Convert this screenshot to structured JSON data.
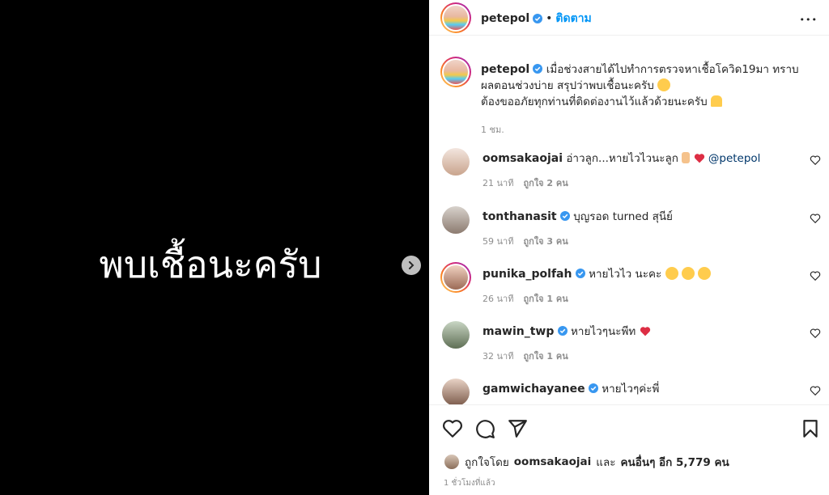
{
  "media": {
    "text": "พบเชื้อนะครับ"
  },
  "header": {
    "username": "petepol",
    "separator": "•",
    "follow_label": "ติดตาม",
    "more_label": "•••"
  },
  "caption": {
    "username": "petepol",
    "line1": "เมื่อช่วงสายได้ไปทำการตรวจหาเชื้อโควิด19มา ทราบผลตอนช่วงบ่าย สรุปว่าพบเชื้อนะครับ",
    "line2": "ต้องขออภัยทุกท่านที่ติดต่องานไว้แล้วด้วยนะครับ",
    "time": "1 ชม."
  },
  "comments": [
    {
      "username": "oomsakaojai",
      "verified": false,
      "text": "อ่าวลูก...หายไวไวนะลูก",
      "mention": "@petepol",
      "time": "21 นาที",
      "likes": "ถูกใจ 2 คน"
    },
    {
      "username": "tonthanasit",
      "verified": true,
      "text": "บุญรอด turned สุนีย์",
      "mention": "",
      "time": "59 นาที",
      "likes": "ถูกใจ 3 คน"
    },
    {
      "username": "punika_polfah",
      "verified": true,
      "text": "หายไวไว นะคะ",
      "mention": "",
      "time": "26 นาที",
      "likes": "ถูกใจ 1 คน"
    },
    {
      "username": "mawin_twp",
      "verified": true,
      "text": "หายไวๆนะพีท",
      "mention": "",
      "time": "32 นาที",
      "likes": "ถูกใจ 1 คน"
    },
    {
      "username": "gamwichayanee",
      "verified": true,
      "text": "หายไวๆค่ะพี่",
      "mention": "",
      "time": "",
      "likes": ""
    }
  ],
  "likes": {
    "prefix": "ถูกใจโดย",
    "user": "oomsakaojai",
    "and": "และ",
    "others": "คนอื่นๆ อีก 5,779 คน"
  },
  "posted": "1 ชั่วโมงที่แล้ว",
  "colors": {
    "accent": "#0095f6",
    "verified": "#3897f0",
    "heart": "#ed4956",
    "muted": "#8e8e8e"
  }
}
